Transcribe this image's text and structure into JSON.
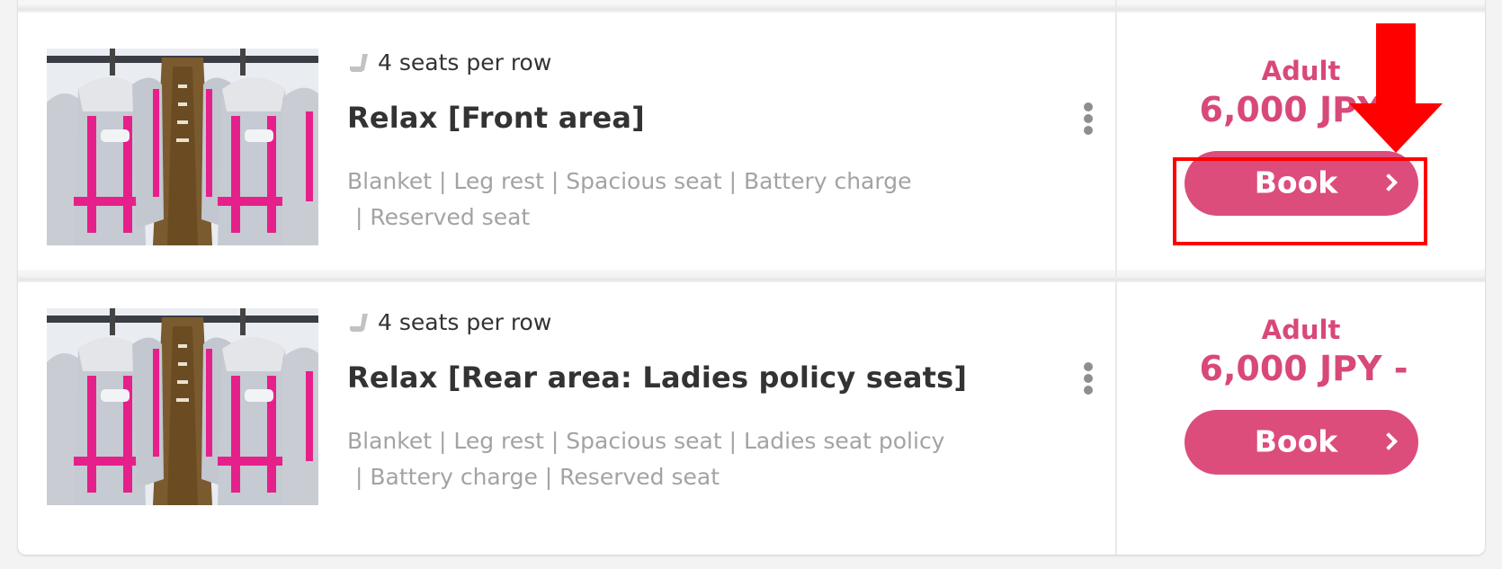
{
  "colors": {
    "accent": "#dc4d7c",
    "price_text": "#d9487a",
    "title_text": "#333333",
    "feature_text": "#a3a3a3",
    "annotation_red": "#ff0000",
    "background": "#f3f3f3"
  },
  "plans": [
    {
      "photo_alt": "bus-interior-seats-photo",
      "seat_icon": "seat-icon",
      "seats_per_row": "4 seats per row",
      "title": "Relax [Front area]",
      "features_line1": "Blanket | Leg rest | Spacious seat | Battery charge",
      "features_line2": "| Reserved seat",
      "menu_icon": "kebab-menu-icon",
      "price_label": "Adult",
      "price": "6,000 JPY -",
      "book_label": "Book",
      "book_icon": "chevron-right-icon",
      "highlighted": true
    },
    {
      "photo_alt": "bus-interior-seats-photo",
      "seat_icon": "seat-icon",
      "seats_per_row": "4 seats per row",
      "title": "Relax [Rear area: Ladies policy seats]",
      "features_line1": "Blanket | Leg rest | Spacious seat | Ladies seat policy",
      "features_line2": "| Battery charge | Reserved seat",
      "menu_icon": "kebab-menu-icon",
      "price_label": "Adult",
      "price": "6,000 JPY -",
      "book_label": "Book",
      "book_icon": "chevron-right-icon",
      "highlighted": false
    }
  ],
  "annotation": {
    "type": "highlight-box-with-down-arrow",
    "target": "plans.0.book_button"
  }
}
